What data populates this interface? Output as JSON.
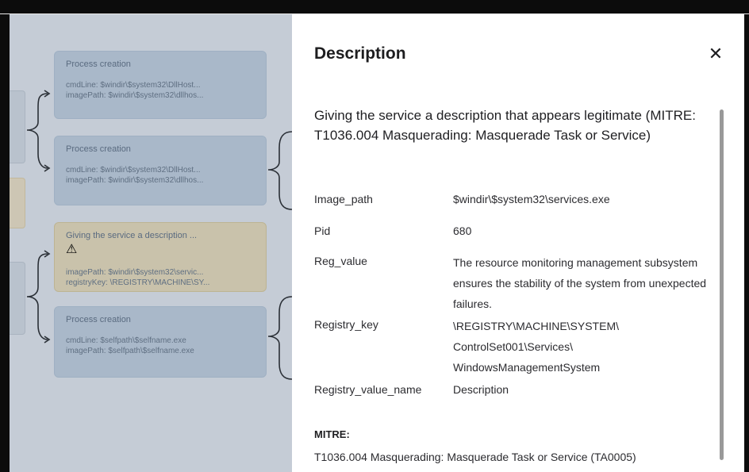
{
  "graph": {
    "nodes": [
      {
        "title": "Process creation",
        "line1": "cmdLine: $windir\\$system32\\DllHost...",
        "line2": "imagePath: $windir\\$system32\\dllhos..."
      },
      {
        "title": "Process creation",
        "line1": "cmdLine: $windir\\$system32\\DllHost...",
        "line2": "imagePath: $windir\\$system32\\dllhos..."
      },
      {
        "title": "Giving the service a description ...",
        "line1": "imagePath: $windir\\$system32\\servic...",
        "line2": "registryKey: \\REGISTRY\\MACHINE\\SY...",
        "warning_icon": "warning-icon"
      },
      {
        "title": "Process creation",
        "line1": "cmdLine: $selfpath\\$selfname.exe",
        "line2": "imagePath: $selfpath\\$selfname.exe"
      }
    ]
  },
  "panel": {
    "title": "Description",
    "close_icon": "close-icon",
    "heading": "Giving the service a description that appears legitimate (MITRE: T1036.004 Masquerading: Masquerade Task or Service)",
    "properties": [
      {
        "key": "Image_path",
        "value": "$windir\\$system32\\services.exe"
      },
      {
        "key": "Pid",
        "value": "680"
      },
      {
        "key": "Reg_value",
        "value": "The resource monitoring management subsystem ensures the stability of the system from unexpected failures."
      },
      {
        "key": "Registry_key",
        "value": "\\REGISTRY\\MACHINE\\SYSTEM\\ ControlSet001\\Services\\ WindowsManagementSystem"
      },
      {
        "key": "Registry_value_name",
        "value": "Description"
      }
    ],
    "mitre_label": "MITRE:",
    "mitre_value": "T1036.004 Masquerading: Masquerade Task or Service (TA0005)"
  },
  "colors": {
    "overlay": "#c5ccd6",
    "node": "#a9b8c9",
    "node_warning": "#c9c2ab",
    "warning_icon": "#c49a2b",
    "panel_bg": "#ffffff"
  }
}
